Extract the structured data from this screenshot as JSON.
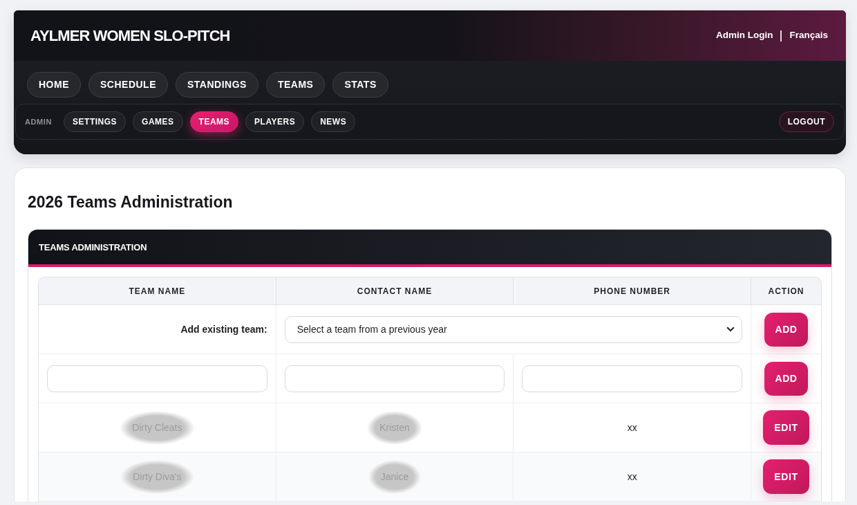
{
  "header": {
    "title": "AYLMER WOMEN SLO-PITCH",
    "links": [
      "Admin Login",
      "Français"
    ]
  },
  "main_nav": [
    {
      "label": "HOME",
      "selected": false
    },
    {
      "label": "SCHEDULE",
      "selected": false
    },
    {
      "label": "STANDINGS",
      "selected": false
    },
    {
      "label": "TEAMS",
      "selected": false
    },
    {
      "label": "STATS",
      "selected": false
    }
  ],
  "admin_nav": {
    "label": "ADMIN",
    "items": [
      {
        "label": "SETTINGS",
        "selected": false
      },
      {
        "label": "GAMES",
        "selected": false
      },
      {
        "label": "TEAMS",
        "selected": true
      },
      {
        "label": "PLAYERS",
        "selected": false
      },
      {
        "label": "NEWS",
        "selected": false
      }
    ],
    "logout": "LOGOUT"
  },
  "page_title": "2026 Teams Administration",
  "panel": {
    "title": "TEAMS ADMINISTRATION",
    "table": {
      "columns": [
        "TEAM NAME",
        "CONTACT NAME",
        "PHONE NUMBER",
        "ACTION"
      ],
      "rows": [
        {
          "kind": "select",
          "label": "Add existing team:",
          "value": "Select a team from a previous year",
          "button": "ADD"
        },
        {
          "kind": "new",
          "button": "ADD"
        },
        {
          "kind": "team",
          "team_name": "Dirty Cleats",
          "contact_name": "Kristen",
          "phone": "xx",
          "blurred": true,
          "button": "EDIT"
        },
        {
          "kind": "team",
          "team_name": "Dirty Diva's",
          "contact_name": "Janice",
          "phone": "xx",
          "blurred": true,
          "button": "EDIT"
        }
      ]
    }
  }
}
